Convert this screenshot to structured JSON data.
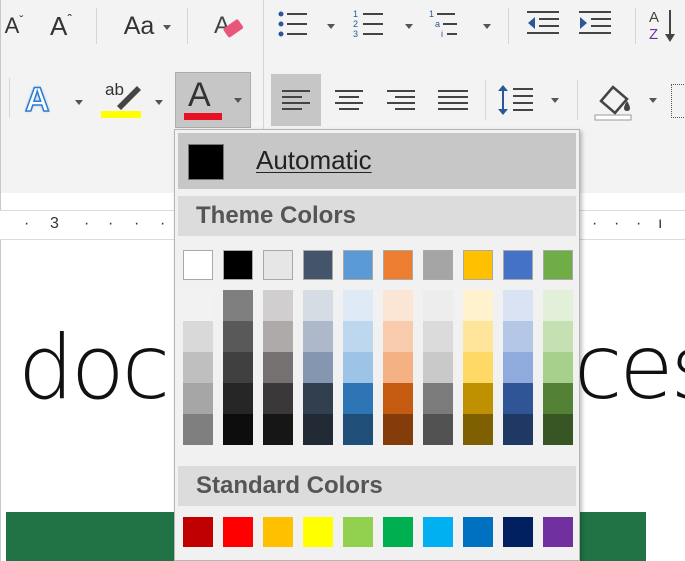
{
  "ribbon": {
    "change_case_label": "Aa",
    "highlight_glyph": "ab",
    "font_color_glyph": "A",
    "text_effects_glyph": "A",
    "sort_glyph": "A↓Z",
    "highlight_color": "#ffff00",
    "font_color": "#e81123"
  },
  "ruler": {
    "marks": [
      "·",
      "3",
      "·",
      "·",
      "·",
      "·",
      "·",
      "·",
      "·",
      "ı"
    ]
  },
  "document": {
    "text_left": "docu",
    "text_right": "ces"
  },
  "menu": {
    "automatic_label": "Automatic",
    "automatic_color": "#000000",
    "theme_header": "Theme Colors",
    "standard_header": "Standard Colors",
    "theme_colors": [
      {
        "base": "#ffffff",
        "shades": [
          "#f2f2f2",
          "#d9d9d9",
          "#bfbfbf",
          "#a6a6a6",
          "#7f7f7f"
        ]
      },
      {
        "base": "#000000",
        "shades": [
          "#7f7f7f",
          "#595959",
          "#404040",
          "#262626",
          "#0d0d0d"
        ]
      },
      {
        "base": "#e7e6e6",
        "shades": [
          "#d0cece",
          "#aeaaaa",
          "#757171",
          "#3a3838",
          "#171616"
        ]
      },
      {
        "base": "#44546a",
        "shades": [
          "#d6dce4",
          "#adb9ca",
          "#8496b0",
          "#323f4f",
          "#222a35"
        ]
      },
      {
        "base": "#5b9bd5",
        "shades": [
          "#deebf6",
          "#bdd7ee",
          "#9dc3e6",
          "#2e75b5",
          "#1f4e79"
        ]
      },
      {
        "base": "#ed7d31",
        "shades": [
          "#fbe5d5",
          "#f8cbad",
          "#f4b183",
          "#c55a11",
          "#843c0b"
        ]
      },
      {
        "base": "#a5a5a5",
        "shades": [
          "#ededed",
          "#dbdbdb",
          "#c9c9c9",
          "#7b7b7b",
          "#525252"
        ]
      },
      {
        "base": "#ffc000",
        "shades": [
          "#fff2cc",
          "#fee599",
          "#ffd965",
          "#bf9000",
          "#7f6000"
        ]
      },
      {
        "base": "#4472c4",
        "shades": [
          "#dae3f3",
          "#b4c7e7",
          "#8faadc",
          "#2f5597",
          "#1f3864"
        ]
      },
      {
        "base": "#70ad47",
        "shades": [
          "#e2efd9",
          "#c5e0b3",
          "#a8d08d",
          "#538135",
          "#375623"
        ]
      }
    ],
    "standard_colors": [
      "#c00000",
      "#ff0000",
      "#ffc000",
      "#ffff00",
      "#92d050",
      "#00b050",
      "#00b0f0",
      "#0070c0",
      "#002060",
      "#7030a0"
    ]
  }
}
